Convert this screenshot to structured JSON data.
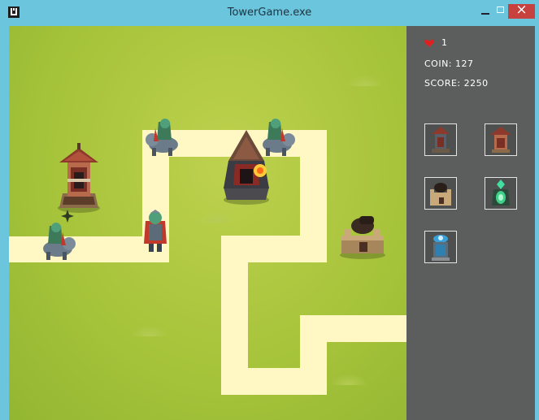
{
  "window": {
    "title": "TowerGame.exe"
  },
  "hud": {
    "lives": "1",
    "coin": "COIN: 127",
    "score": "SCORE: 2250"
  },
  "shop": [
    {
      "name": "tower-shop-slot-1",
      "icon": "pagoda-tower-icon"
    },
    {
      "name": "tower-shop-slot-2",
      "icon": "pagoda-tower-icon"
    },
    {
      "name": "tower-shop-slot-3",
      "icon": "cannon-tower-icon"
    },
    {
      "name": "tower-shop-slot-4",
      "icon": "crystal-tower-icon"
    },
    {
      "name": "tower-shop-slot-5",
      "icon": "tesla-tower-icon"
    }
  ],
  "colors": {
    "grass": "#a7c43b",
    "path": "#fff8c4",
    "panel": "#5c5e5d",
    "titlebar": "#6bc6dd",
    "close": "#c7413e"
  }
}
